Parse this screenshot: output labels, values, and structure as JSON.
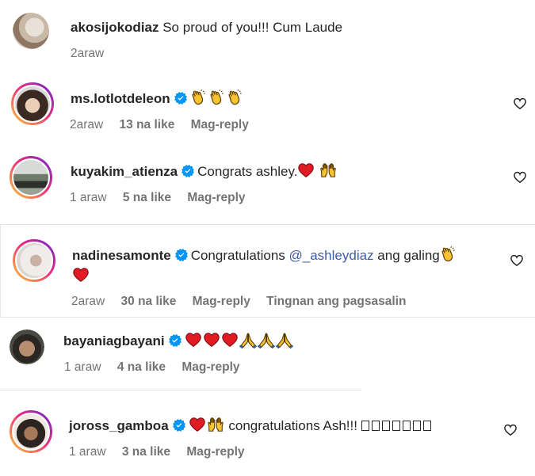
{
  "comments": [
    {
      "username": "akosijokodiaz",
      "verified": false,
      "text": "So proud of you!!! Cum Laude",
      "time": "2araw",
      "likes": "",
      "reply": ""
    },
    {
      "username": "ms.lotlotdeleon",
      "verified": true,
      "emojis": [
        "clapping-hands",
        "clapping-hands",
        "clapping-hands"
      ],
      "time": "2araw",
      "likes": "13 na like",
      "reply": "Mag-reply"
    },
    {
      "username": "kuyakim_atienza",
      "verified": true,
      "text": "Congrats ashley.",
      "emojis": [
        "red-heart",
        "raising-hands"
      ],
      "time": "1 araw",
      "likes": "5 na like",
      "reply": "Mag-reply"
    },
    {
      "username": "nadinesamonte",
      "verified": true,
      "text_before": "Congratulations",
      "mention": "@_ashleydiaz",
      "text_after": "ang galing",
      "emojis": [
        "clapping-hands",
        "red-heart"
      ],
      "time": "2araw",
      "likes": "30 na like",
      "reply": "Mag-reply",
      "translate": "Tingnan ang pagsasalin"
    },
    {
      "username": "bayaniagbayani",
      "verified": true,
      "emojis": [
        "red-heart",
        "red-heart",
        "red-heart",
        "folded-hands",
        "folded-hands",
        "folded-hands"
      ],
      "time": "1 araw",
      "likes": "4 na like",
      "reply": "Mag-reply"
    },
    {
      "username": "joross_gamboa",
      "verified": true,
      "emojis": [
        "red-heart",
        "raising-hands"
      ],
      "text": "congratulations Ash!!!",
      "trailing_glyphs": 7,
      "time": "1 araw",
      "likes": "3 na like",
      "reply": "Mag-reply"
    }
  ],
  "colors": {
    "username": "#262626",
    "meta": "#737373",
    "mention": "#3f5ba8",
    "verified": "#0095f6",
    "heart": "#ed1c24"
  },
  "icons": [
    "verified-badge-icon",
    "like-heart-icon",
    "clapping-hands-emoji",
    "red-heart-emoji",
    "raising-hands-emoji",
    "folded-hands-emoji"
  ]
}
